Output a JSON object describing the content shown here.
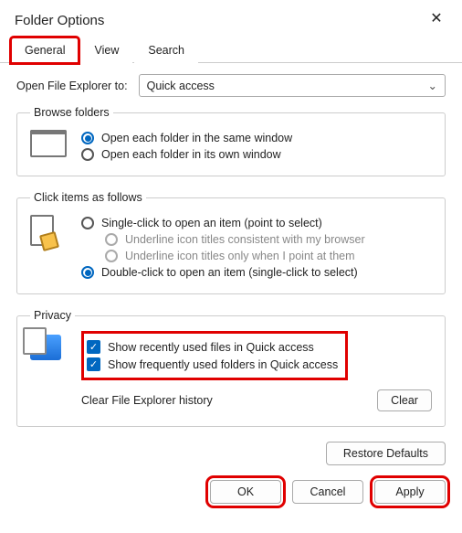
{
  "window": {
    "title": "Folder Options"
  },
  "tabs": [
    "General",
    "View",
    "Search"
  ],
  "openExplorer": {
    "label": "Open File Explorer to:",
    "value": "Quick access"
  },
  "browseFolders": {
    "legend": "Browse folders",
    "opt1": "Open each folder in the same window",
    "opt2": "Open each folder in its own window"
  },
  "clickItems": {
    "legend": "Click items as follows",
    "single": "Single-click to open an item (point to select)",
    "underlineBrowser": "Underline icon titles consistent with my browser",
    "underlinePoint": "Underline icon titles only when I point at them",
    "double": "Double-click to open an item (single-click to select)"
  },
  "privacy": {
    "legend": "Privacy",
    "recent": "Show recently used files in Quick access",
    "frequent": "Show frequently used folders in Quick access",
    "clearLabel": "Clear File Explorer history",
    "clearBtn": "Clear"
  },
  "restore": "Restore Defaults",
  "footer": {
    "ok": "OK",
    "cancel": "Cancel",
    "apply": "Apply"
  }
}
